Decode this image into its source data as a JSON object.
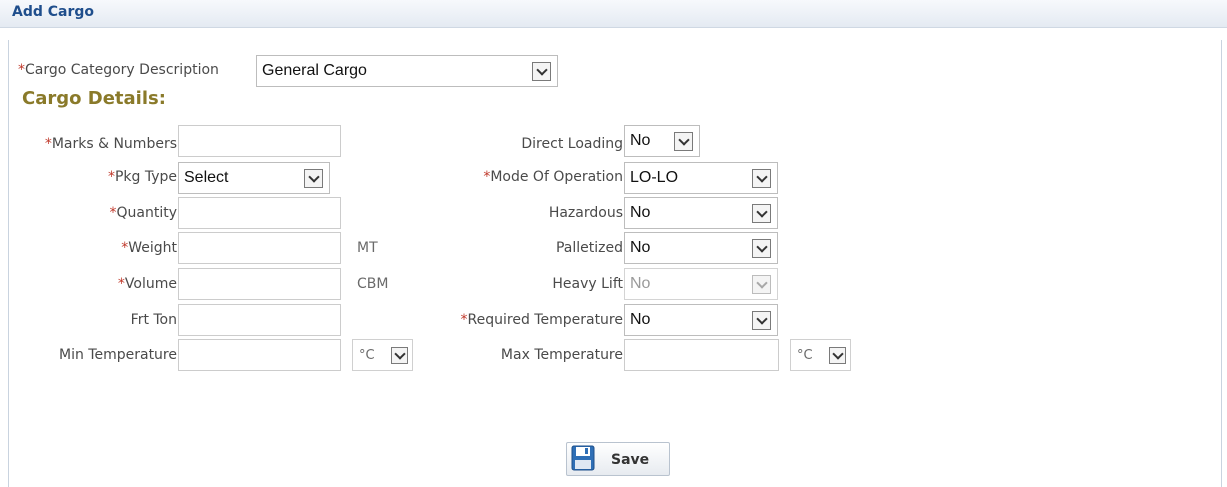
{
  "header": {
    "title": "Add Cargo"
  },
  "category": {
    "required_mark": "*",
    "label": "Cargo Category Description",
    "value": "General Cargo"
  },
  "section_title": "Cargo Details:",
  "left_fields": {
    "marks_numbers": {
      "required_mark": "*",
      "label": "Marks & Numbers",
      "value": ""
    },
    "pkg_type": {
      "required_mark": "*",
      "label": "Pkg Type",
      "value": "Select"
    },
    "quantity": {
      "required_mark": "*",
      "label": "Quantity",
      "value": ""
    },
    "weight": {
      "required_mark": "*",
      "label": "Weight",
      "value": "",
      "unit": "MT"
    },
    "volume": {
      "required_mark": "*",
      "label": "Volume",
      "value": "",
      "unit": "CBM"
    },
    "frt_ton": {
      "label": "Frt Ton",
      "value": ""
    },
    "min_temperature": {
      "label": "Min Temperature",
      "value": "",
      "unit": "°C"
    }
  },
  "right_fields": {
    "direct_loading": {
      "label": "Direct Loading",
      "value": "No"
    },
    "mode_of_operation": {
      "required_mark": "*",
      "label": "Mode Of Operation",
      "value": "LO-LO"
    },
    "hazardous": {
      "label": "Hazardous",
      "value": "No"
    },
    "palletized": {
      "label": "Palletized",
      "value": "No"
    },
    "heavy_lift": {
      "label": "Heavy Lift",
      "value": "No",
      "disabled": true
    },
    "required_temperature": {
      "required_mark": "*",
      "label": "Required Temperature",
      "value": "No"
    },
    "max_temperature": {
      "label": "Max Temperature",
      "value": "",
      "unit": "°C"
    }
  },
  "actions": {
    "save_label": "Save",
    "save_icon": "floppy-disk-icon"
  },
  "colors": {
    "title": "#1f4e8c",
    "section": "#8a7a2a",
    "required": "#c0392b"
  }
}
